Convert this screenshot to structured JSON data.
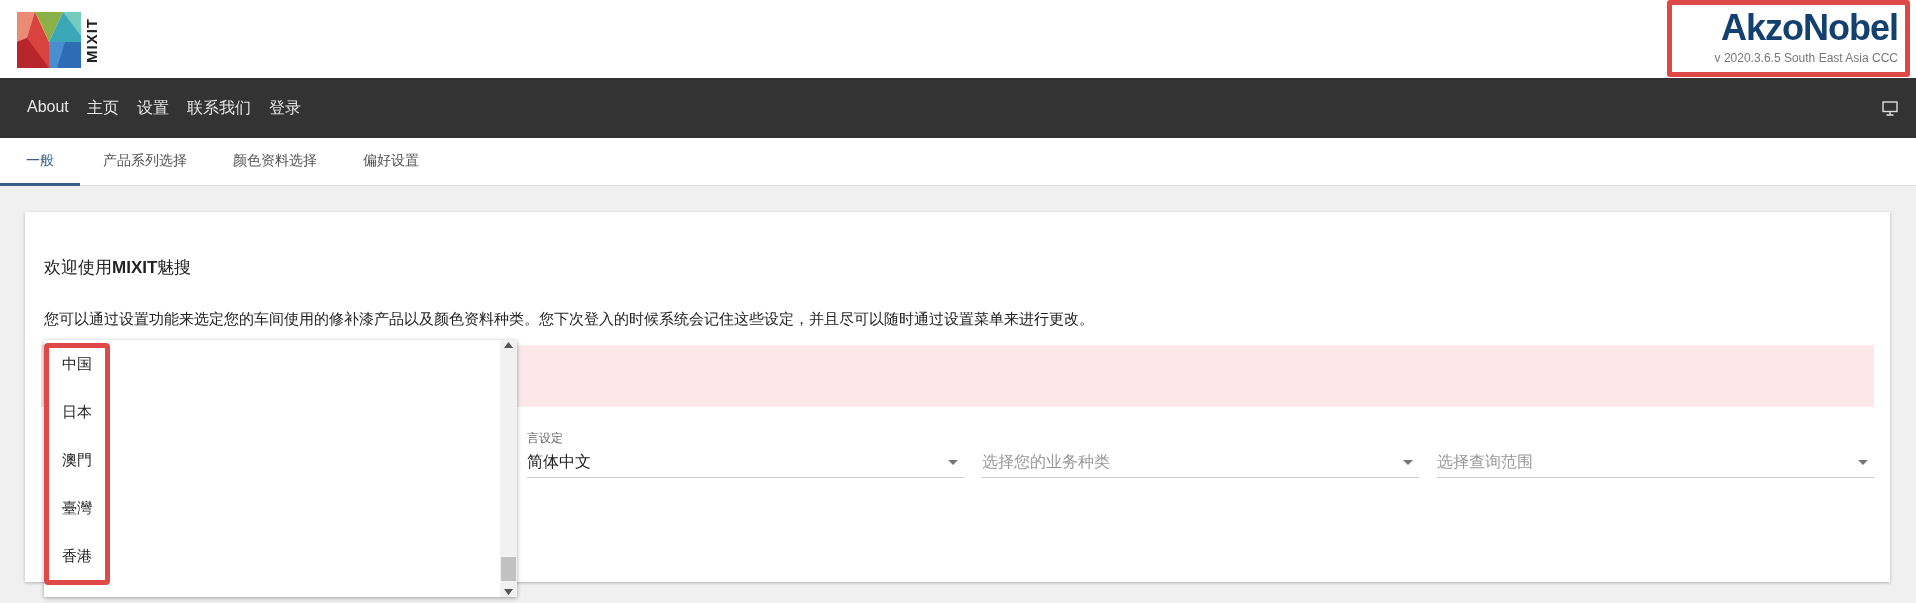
{
  "logo": {
    "text": "MIXIT"
  },
  "brand": {
    "name": "AkzoNobel",
    "version": "v 2020.3.6.5 South East Asia CCC",
    "highlighted": true
  },
  "nav": {
    "items": [
      "About",
      "主页",
      "设置",
      "联系我们",
      "登录"
    ]
  },
  "tabs": [
    {
      "label": "一般",
      "selected": true
    },
    {
      "label": "产品系列选择",
      "selected": false
    },
    {
      "label": "颜色资料选择",
      "selected": false
    },
    {
      "label": "偏好设置",
      "selected": false
    }
  ],
  "card": {
    "title": "欢迎使用**MIXIT**魅搜",
    "description": "您可以通过设置功能来选定您的车间使用的修补漆产品以及颜色资料种类。您下次登入的时候系统会记住这些设定，并且尽可以随时通过设置菜单来进行更改。",
    "fields": [
      {
        "label": "言设定",
        "value": "简体中文"
      },
      {
        "placeholder": "选择您的业务种类"
      },
      {
        "placeholder": "选择查询范围"
      }
    ]
  },
  "dropdown": {
    "highlighted": true,
    "options": [
      "中国",
      "日本",
      "澳門",
      "臺灣",
      "香港"
    ]
  }
}
